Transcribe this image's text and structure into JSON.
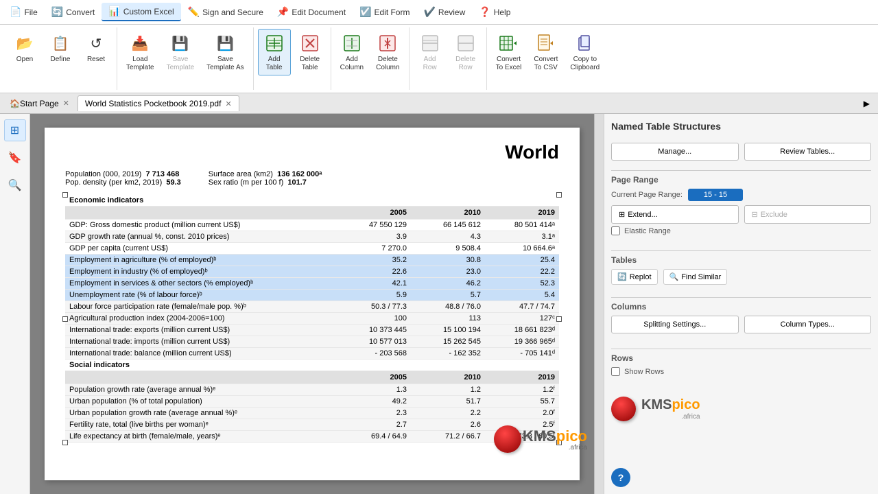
{
  "menubar": {
    "items": [
      {
        "label": "File",
        "icon": "📄",
        "active": false
      },
      {
        "label": "Convert",
        "icon": "🔄",
        "active": false
      },
      {
        "label": "Custom Excel",
        "icon": "📊",
        "active": true
      },
      {
        "label": "Sign and Secure",
        "icon": "✏️",
        "active": false
      },
      {
        "label": "Edit Document",
        "icon": "📌",
        "active": false
      },
      {
        "label": "Edit Form",
        "icon": "☑️",
        "active": false
      },
      {
        "label": "Review",
        "icon": "✔️",
        "active": false
      },
      {
        "label": "Help",
        "icon": "❓",
        "active": false
      }
    ]
  },
  "ribbon": {
    "groups": [
      {
        "label": "",
        "buttons": [
          {
            "label": "Open",
            "icon": "📂",
            "disabled": false,
            "id": "open"
          },
          {
            "label": "Define",
            "icon": "📋",
            "disabled": false,
            "id": "define"
          },
          {
            "label": "Reset",
            "icon": "↺",
            "disabled": false,
            "id": "reset"
          }
        ]
      },
      {
        "label": "",
        "buttons": [
          {
            "label": "Load Template",
            "icon": "📥",
            "disabled": false,
            "id": "load-template"
          },
          {
            "label": "Save Template",
            "icon": "💾",
            "disabled": true,
            "id": "save-template"
          },
          {
            "label": "Save Template As",
            "icon": "💾",
            "disabled": false,
            "id": "save-template-as",
            "highlight": false
          }
        ]
      },
      {
        "label": "",
        "buttons": [
          {
            "label": "Add Table",
            "icon": "➕",
            "disabled": false,
            "id": "add-table",
            "highlight": true
          },
          {
            "label": "Delete Table",
            "icon": "🗑",
            "disabled": false,
            "id": "delete-table"
          }
        ]
      },
      {
        "label": "",
        "buttons": [
          {
            "label": "Add Column",
            "icon": "➕",
            "disabled": false,
            "id": "add-column"
          },
          {
            "label": "Delete Column",
            "icon": "🗑",
            "disabled": false,
            "id": "delete-column"
          }
        ]
      },
      {
        "label": "",
        "buttons": [
          {
            "label": "Add Row",
            "icon": "➕",
            "disabled": true,
            "id": "add-row"
          },
          {
            "label": "Delete Row",
            "icon": "🗑",
            "disabled": true,
            "id": "delete-row"
          }
        ]
      },
      {
        "label": "",
        "buttons": [
          {
            "label": "Convert To Excel",
            "icon": "📊",
            "disabled": false,
            "id": "convert-excel"
          },
          {
            "label": "Convert To CSV",
            "icon": "📄",
            "disabled": false,
            "id": "convert-csv"
          },
          {
            "label": "Copy to Clipboard",
            "icon": "📋",
            "disabled": false,
            "id": "copy-clipboard"
          }
        ]
      }
    ]
  },
  "tabs": {
    "home": {
      "label": "Start Page",
      "icon": "🏠"
    },
    "items": [
      {
        "label": "World Statistics Pocketbook 2019.pdf",
        "active": true
      }
    ]
  },
  "right_panel": {
    "title": "Named Table Structures",
    "manage_label": "Manage...",
    "review_tables_label": "Review Tables...",
    "page_range": {
      "label": "Page Range",
      "current_label": "Current Page Range:",
      "value": "15 - 15",
      "extend_label": "Extend...",
      "exclude_label": "Exclude",
      "elastic_range_label": "Elastic Range"
    },
    "tables": {
      "label": "Tables",
      "replot_label": "Replot",
      "find_similar_label": "Find Similar"
    },
    "columns": {
      "label": "Columns",
      "splitting_label": "Splitting Settings...",
      "column_types_label": "Column Types..."
    },
    "rows": {
      "label": "Rows",
      "show_rows_label": "Show Rows"
    }
  },
  "document": {
    "title": "World",
    "meta": [
      {
        "key": "Population (000, 2019)",
        "value": "7 713 468"
      },
      {
        "key": "Pop. density (per km2, 2019)",
        "value": "59.3"
      },
      {
        "key": "Surface area (km2)",
        "value": "136 162 000ᵃ"
      },
      {
        "key": "Sex ratio (m per 100 f)",
        "value": "101.7"
      }
    ],
    "sections": [
      {
        "name": "Economic indicators",
        "headers": [
          "",
          "2005",
          "2010",
          "2019"
        ],
        "rows": [
          {
            "label": "GDP: Gross domestic product (million current US$)",
            "v2005": "47 550 129",
            "v2010": "66 145 612",
            "v2019": "80 501 414ᵃ"
          },
          {
            "label": "GDP growth rate (annual %, const. 2010 prices)",
            "v2005": "3.9",
            "v2010": "4.3",
            "v2019": "3.1ᵃ"
          },
          {
            "label": "GDP per capita (current US$)",
            "v2005": "7 270.0",
            "v2010": "9 508.4",
            "v2019": "10 664.6ᵃ"
          },
          {
            "label": "Employment in agriculture (% of employed)ᵇ",
            "v2005": "35.2",
            "v2010": "30.8",
            "v2019": "25.4",
            "selected": true
          },
          {
            "label": "Employment in industry (% of employed)ᵇ",
            "v2005": "22.6",
            "v2010": "23.0",
            "v2019": "22.2",
            "selected": true
          },
          {
            "label": "Employment in services & other sectors (% employed)ᵇ",
            "v2005": "42.1",
            "v2010": "46.2",
            "v2019": "52.3",
            "selected": true
          },
          {
            "label": "Unemployment rate (% of labour force)ᵇ",
            "v2005": "5.9",
            "v2010": "5.7",
            "v2019": "5.4",
            "selected": true
          },
          {
            "label": "Labour force participation rate (female/male pop. %)ᵇ",
            "v2005": "50.3 / 77.3",
            "v2010": "48.8 / 76.0",
            "v2019": "47.7 / 74.7"
          },
          {
            "label": "Agricultural production index (2004-2006=100)",
            "v2005": "100",
            "v2010": "113",
            "v2019": "127ᶜ"
          },
          {
            "label": "International trade: exports (million current US$)",
            "v2005": "10 373 445",
            "v2010": "15 100 194",
            "v2019": "18 661 823ᵈ"
          },
          {
            "label": "International trade: imports (million current US$)",
            "v2005": "10 577 013",
            "v2010": "15 262 545",
            "v2019": "19 366 965ᵈ"
          },
          {
            "label": "International trade: balance (million current US$)",
            "v2005": "- 203 568",
            "v2010": "- 162 352",
            "v2019": "- 705 141ᵈ"
          }
        ]
      },
      {
        "name": "Social indicators",
        "headers": [
          "",
          "2005",
          "2010",
          "2019"
        ],
        "rows": [
          {
            "label": "Population growth rate (average annual %)ᵉ",
            "v2005": "1.3",
            "v2010": "1.2",
            "v2019": "1.2ᶠ"
          },
          {
            "label": "Urban population (% of total population)",
            "v2005": "49.2",
            "v2010": "51.7",
            "v2019": "55.7"
          },
          {
            "label": "Urban population growth rate (average annual %)ᵉ",
            "v2005": "2.3",
            "v2010": "2.2",
            "v2019": "2.0ᶠ"
          },
          {
            "label": "Fertility rate, total (live births per woman)ᵉ",
            "v2005": "2.7",
            "v2010": "2.6",
            "v2019": "2.5ᶠ"
          },
          {
            "label": "Life expectancy at birth (female/male, years)ᵉ",
            "v2005": "69.4 / 64.9",
            "v2010": "71.2 / 66.7",
            "v2019": "73.3 / 69.5ᶠ"
          }
        ]
      }
    ]
  }
}
